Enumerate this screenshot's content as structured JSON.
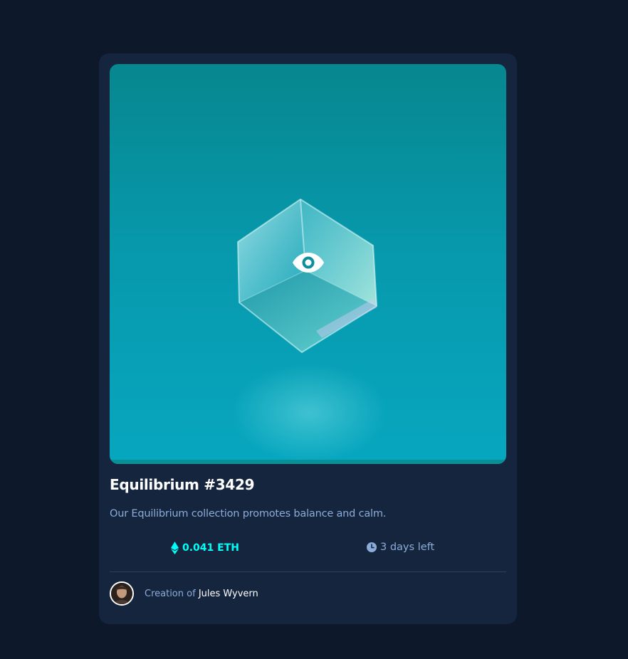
{
  "card": {
    "title": "Equilibrium #3429",
    "description": "Our Equilibrium collection promotes balance and calm.",
    "price": "0.041 ETH",
    "time_left": "3 days left",
    "creator_prefix": "Creation of",
    "creator_name": "Jules Wyvern"
  },
  "icons": {
    "view": "eye-icon",
    "price": "ethereum-icon",
    "time": "clock-icon"
  },
  "colors": {
    "page_background": "#0d192b",
    "card_background": "#15253e",
    "cyan": "#00fff7",
    "soft_blue": "#8bacd9",
    "white": "#ffffff",
    "image_teal": "#0798ab"
  }
}
